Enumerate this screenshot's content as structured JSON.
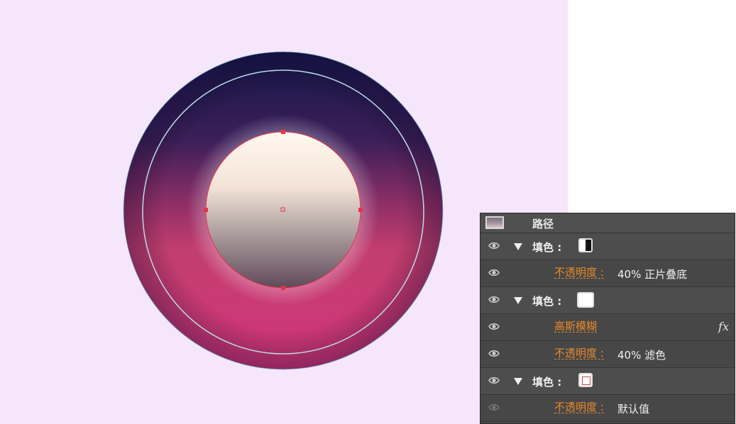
{
  "appearance_panel": {
    "header": {
      "label": "路径",
      "icon": "path-thumbnail-icon"
    },
    "rows": [
      {
        "type": "fill",
        "label": "填色 :",
        "swatch": "gradient-swatch",
        "visible": true
      },
      {
        "type": "attribute",
        "link": "不透明度 :",
        "value": "40%  正片叠底",
        "visible": true
      },
      {
        "type": "fill",
        "label": "填色 :",
        "swatch": "white-swatch",
        "visible": true
      },
      {
        "type": "effect",
        "link": "高斯模糊",
        "fx": "fx",
        "visible": true
      },
      {
        "type": "attribute",
        "link": "不透明度 :",
        "value": "40%  滤色",
        "visible": true
      },
      {
        "type": "fill",
        "label": "填色 :",
        "swatch": "white-outline-swatch",
        "visible": true
      },
      {
        "type": "attribute",
        "link": "不透明度 :",
        "value": "默认值",
        "visible": false
      }
    ]
  },
  "colors": {
    "canvas_background": "#f5e6fb",
    "panel_background": "#4a4a4a",
    "link_orange": "#e88a2a",
    "anchor_red": "#e8334a",
    "guide_cyan": "#9fd6e8",
    "outer_top": "#1c1a4e",
    "outer_mid": "#b83a6c",
    "outer_bottom": "#d03a75",
    "inner_top": "#fff6ea",
    "inner_bottom": "#6e5a64"
  }
}
